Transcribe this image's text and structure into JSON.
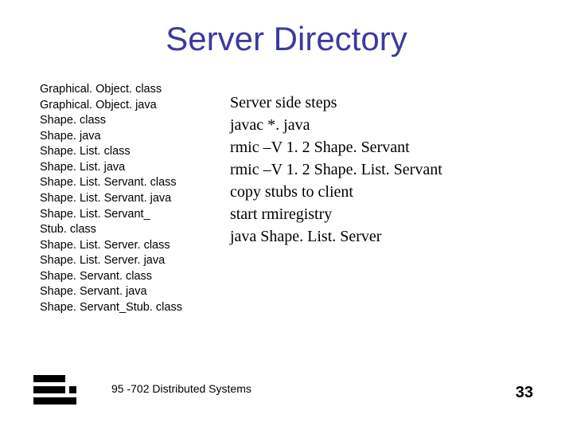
{
  "title": "Server Directory",
  "left": {
    "items": [
      "Graphical. Object. class",
      "Graphical. Object. java",
      "Shape. class",
      "Shape. java",
      "Shape. List. class",
      "Shape. List. java",
      "Shape. List. Servant. class",
      "Shape. List. Servant. java",
      "Shape. List. Servant_",
      "Stub. class",
      "Shape. List. Server. class",
      "Shape. List. Server. java",
      "Shape. Servant. class",
      "Shape. Servant. java",
      "Shape. Servant_Stub. class"
    ]
  },
  "right": {
    "items": [
      "Server side steps",
      "javac *. java",
      "rmic –V 1. 2 Shape. Servant",
      "rmic –V 1. 2 Shape. List. Servant",
      "copy stubs to client",
      "start rmiregistry",
      "java Shape. List. Server"
    ]
  },
  "footer": {
    "text": "95 -702 Distributed Systems"
  },
  "page_number": "33"
}
